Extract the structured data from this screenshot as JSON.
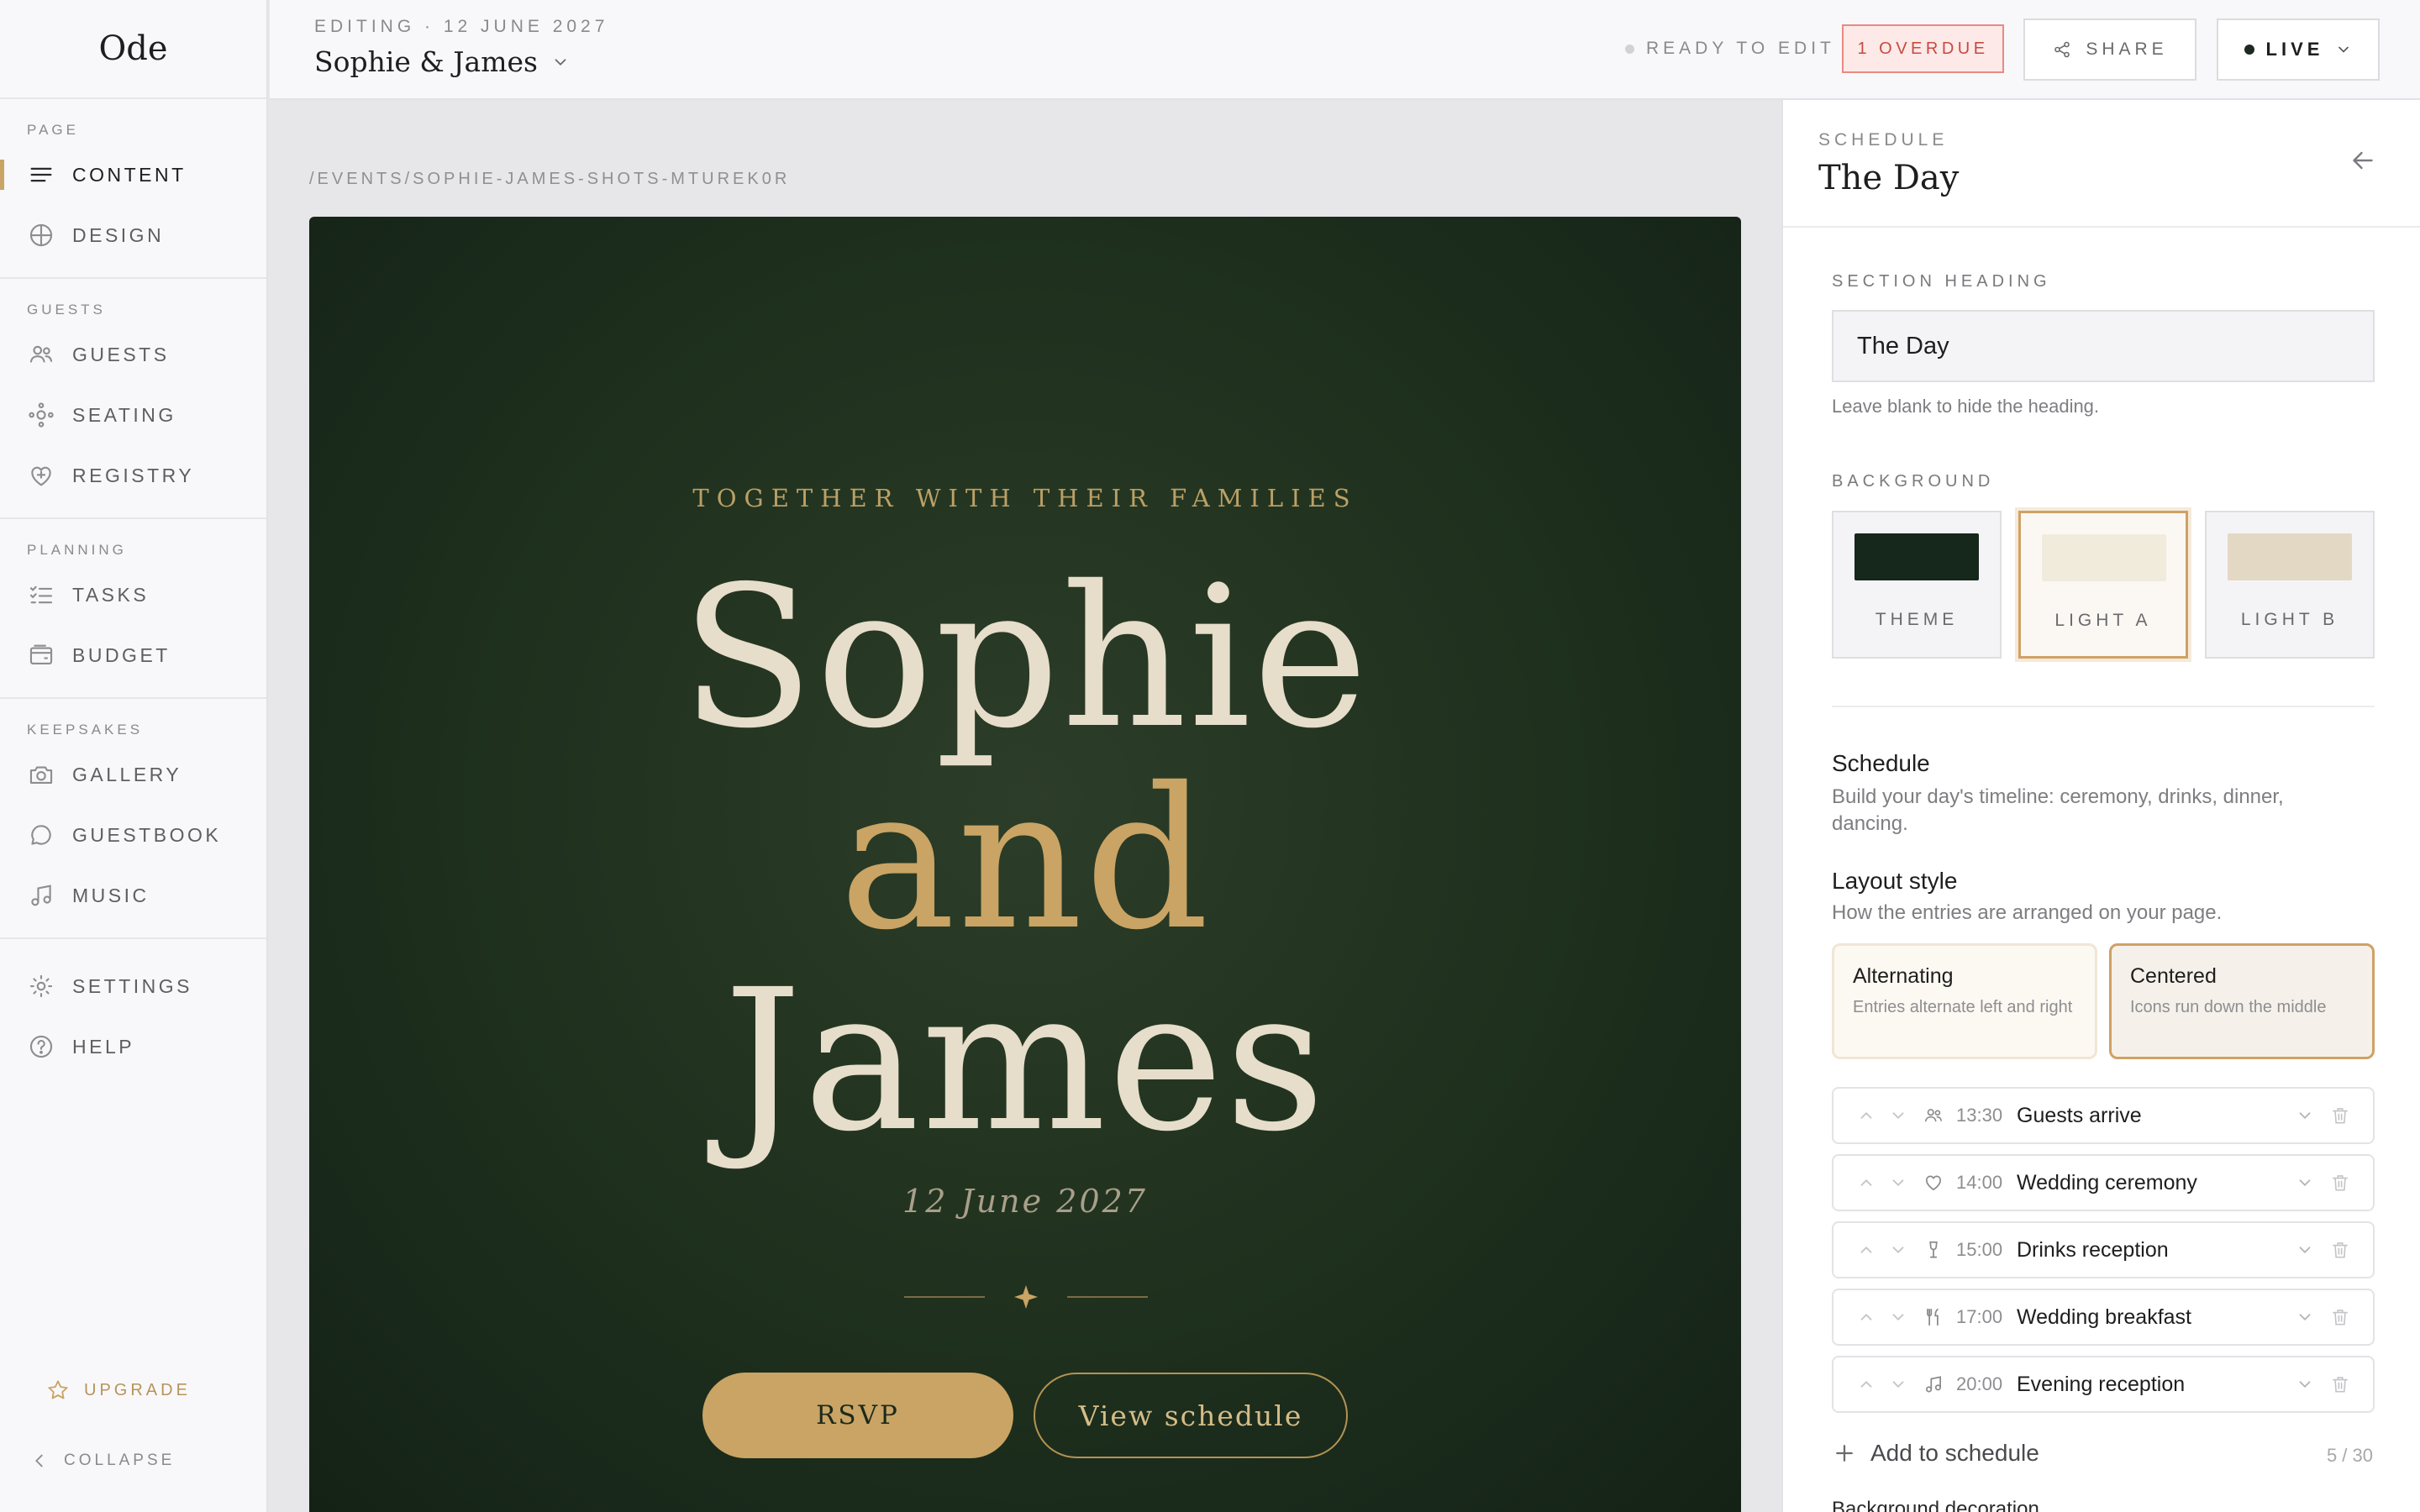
{
  "app": {
    "logo": "Ode"
  },
  "sidebar": {
    "sections": [
      {
        "label": "PAGE",
        "items": [
          {
            "label": "CONTENT",
            "icon": "lines-icon",
            "active": true
          },
          {
            "label": "DESIGN",
            "icon": "globe-icon"
          }
        ]
      },
      {
        "label": "GUESTS",
        "items": [
          {
            "label": "GUESTS",
            "icon": "users-icon"
          },
          {
            "label": "SEATING",
            "icon": "seating-icon"
          },
          {
            "label": "REGISTRY",
            "icon": "gift-heart-icon"
          }
        ]
      },
      {
        "label": "PLANNING",
        "items": [
          {
            "label": "TASKS",
            "icon": "checklist-icon"
          },
          {
            "label": "BUDGET",
            "icon": "wallet-icon"
          }
        ]
      },
      {
        "label": "KEEPSAKES",
        "items": [
          {
            "label": "GALLERY",
            "icon": "camera-icon"
          },
          {
            "label": "GUESTBOOK",
            "icon": "chat-bubble-icon"
          },
          {
            "label": "MUSIC",
            "icon": "music-note-icon"
          }
        ]
      },
      {
        "label": "",
        "items": [
          {
            "label": "SETTINGS",
            "icon": "gear-icon"
          },
          {
            "label": "HELP",
            "icon": "help-circle-icon"
          }
        ]
      }
    ],
    "upgrade": "UPGRADE",
    "collapse": "COLLAPSE"
  },
  "topbar": {
    "editing": "EDITING · 12 JUNE 2027",
    "title": "Sophie & James",
    "status": "READY TO EDIT",
    "overdue": "1 OVERDUE",
    "share": "SHARE",
    "live": "LIVE"
  },
  "canvas": {
    "path": "/EVENTS/SOPHIE-JAMES-SHOTS-MTUREK0R",
    "hero": {
      "tagline": "TOGETHER WITH THEIR FAMILIES",
      "name1": "Sophie",
      "and": "and",
      "name2": "James",
      "date": "12 June 2027",
      "rsvp": "RSVP",
      "view_schedule": "View schedule"
    }
  },
  "panel": {
    "eyebrow": "SCHEDULE",
    "title": "The Day",
    "section_heading_label": "SECTION HEADING",
    "section_heading_value": "The Day",
    "section_heading_hint": "Leave blank to hide the heading.",
    "background_label": "BACKGROUND",
    "backgrounds": [
      {
        "label": "THEME",
        "color": "#16271b"
      },
      {
        "label": "LIGHT A",
        "color": "#f1ebdc",
        "selected": true
      },
      {
        "label": "LIGHT B",
        "color": "#e3d8c3"
      }
    ],
    "schedule_title": "Schedule",
    "schedule_desc": "Build your day's timeline: ceremony, drinks, dinner, dancing.",
    "layout_title": "Layout style",
    "layout_desc": "How the entries are arranged on your page.",
    "layouts": [
      {
        "title": "Alternating",
        "desc": "Entries alternate left and right"
      },
      {
        "title": "Centered",
        "desc": "Icons run down the middle",
        "selected": true
      }
    ],
    "entries": [
      {
        "time": "13:30",
        "name": "Guests arrive",
        "icon": "users-icon"
      },
      {
        "time": "14:00",
        "name": "Wedding ceremony",
        "icon": "heart-icon"
      },
      {
        "time": "15:00",
        "name": "Drinks reception",
        "icon": "glass-icon"
      },
      {
        "time": "17:00",
        "name": "Wedding breakfast",
        "icon": "cutlery-icon"
      },
      {
        "time": "20:00",
        "name": "Evening reception",
        "icon": "music-note-icon"
      }
    ],
    "add_label": "Add to schedule",
    "count": "5 / 30",
    "next_section": "Background decoration"
  },
  "colors": {
    "accent": "#c9a464",
    "hero_bg": "#1f301f",
    "overdue": "#c64a40"
  }
}
